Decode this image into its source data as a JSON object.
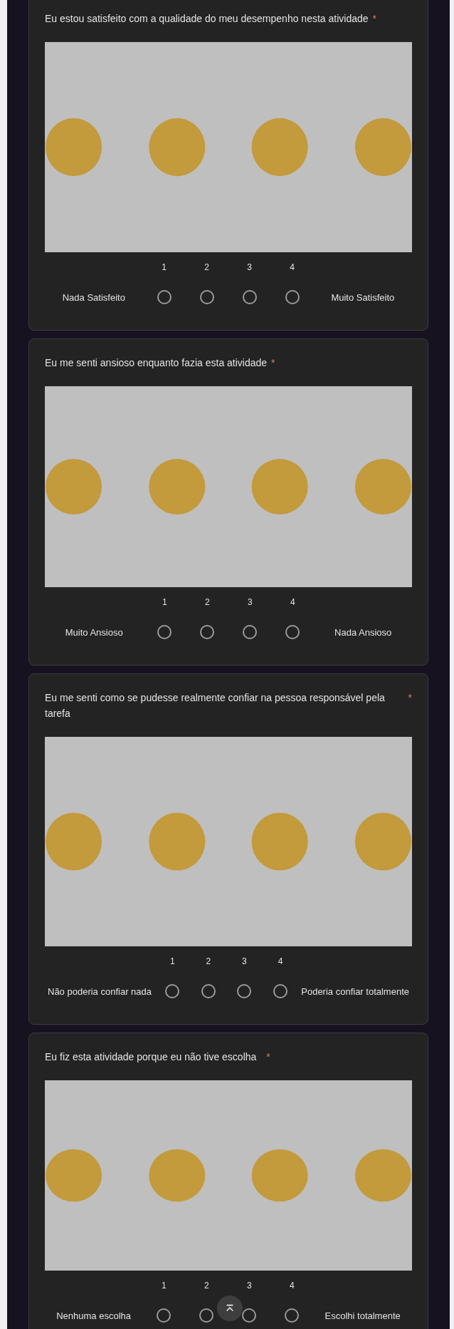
{
  "questions": [
    {
      "title": "Eu estou satisfeito com a qualidade do meu desempenho nesta atividade",
      "required_mark": "*",
      "scale": {
        "min_label": "Nada Satisfeito",
        "max_label": "Muito Satisfeito",
        "options": [
          {
            "label": "1",
            "selected": false
          },
          {
            "label": "2",
            "selected": false
          },
          {
            "label": "3",
            "selected": false
          },
          {
            "label": "4",
            "selected": false
          }
        ]
      }
    },
    {
      "title": "Eu me senti ansioso enquanto fazia esta atividade",
      "required_mark": "*",
      "scale": {
        "min_label": "Muito Ansioso",
        "max_label": "Nada Ansioso",
        "options": [
          {
            "label": "1",
            "selected": false
          },
          {
            "label": "2",
            "selected": false
          },
          {
            "label": "3",
            "selected": false
          },
          {
            "label": "4",
            "selected": false
          }
        ]
      }
    },
    {
      "title": "Eu me senti como se pudesse realmente confiar na pessoa responsável pela tarefa",
      "required_mark": "*",
      "scale": {
        "min_label": "Não poderia confiar nada",
        "max_label": "Poderia confiar totalmente",
        "options": [
          {
            "label": "1",
            "selected": false
          },
          {
            "label": "2",
            "selected": false
          },
          {
            "label": "3",
            "selected": false
          },
          {
            "label": "4",
            "selected": false
          }
        ]
      }
    },
    {
      "title": "Eu fiz esta atividade porque eu não tive escolha",
      "required_mark": "*",
      "scale": {
        "min_label": "Nenhuma escolha",
        "max_label": "Escolhi totalmente",
        "options": [
          {
            "label": "1",
            "selected": false
          },
          {
            "label": "2",
            "selected": false
          },
          {
            "label": "3",
            "selected": false
          },
          {
            "label": "4",
            "selected": false
          }
        ]
      }
    }
  ]
}
